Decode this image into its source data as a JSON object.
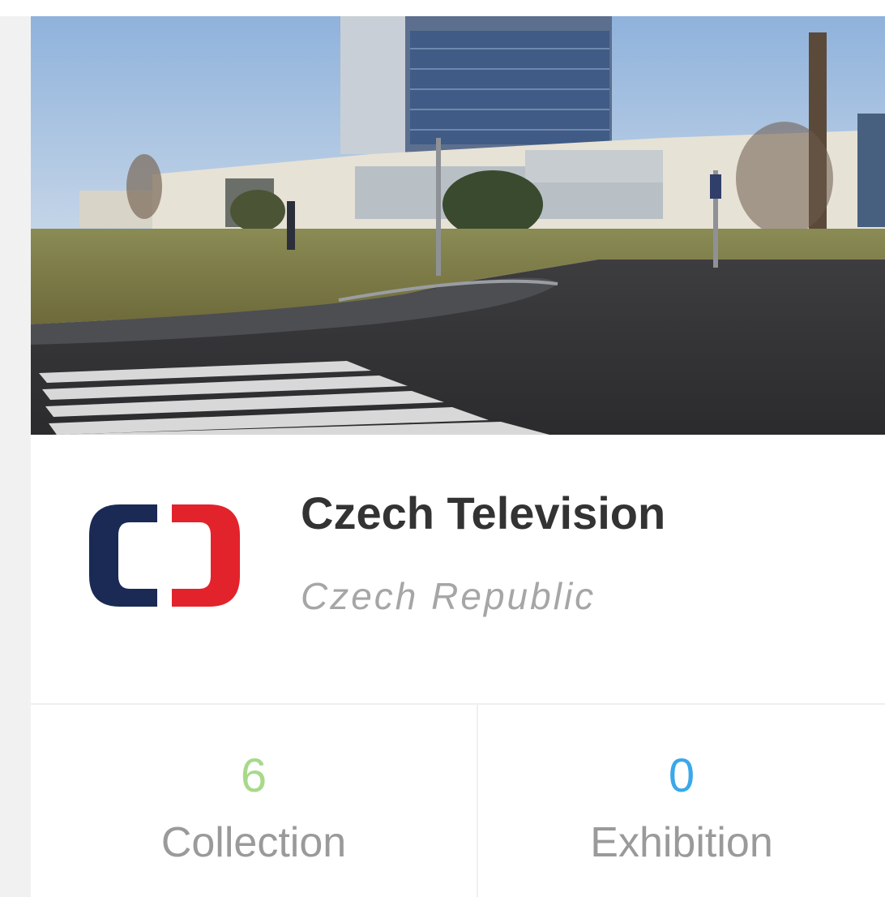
{
  "organization": {
    "name": "Czech Television",
    "country": "Czech Republic"
  },
  "stats": {
    "collection": {
      "value": "6",
      "label": "Collection"
    },
    "exhibition": {
      "value": "0",
      "label": "Exhibition"
    }
  },
  "colors": {
    "collection_value": "#a8d98a",
    "exhibition_value": "#3aa8ea",
    "logo_left": "#1a2a55",
    "logo_right": "#e3232b"
  },
  "icons": {
    "logo": "czech-television-logo"
  }
}
